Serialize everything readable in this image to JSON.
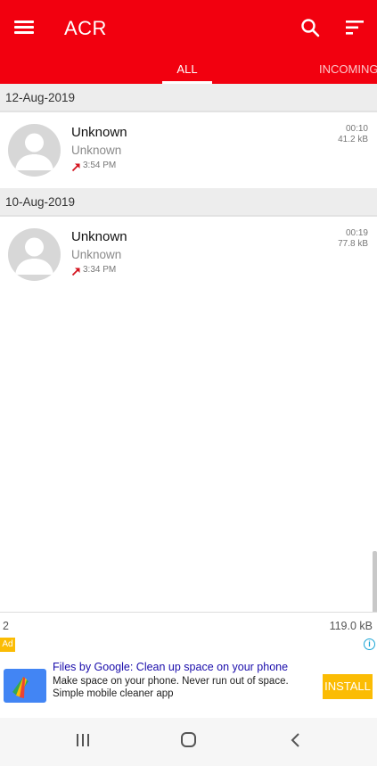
{
  "app": {
    "title": "ACR",
    "brand_color": "#f2000f"
  },
  "toolbar": {
    "menu_icon": "hamburger-menu-icon",
    "search_icon": "search-icon",
    "sort_icon": "sort-icon"
  },
  "tabs": [
    {
      "label": "ALL",
      "selected": true
    },
    {
      "label": "INCOMING",
      "selected": false
    }
  ],
  "groups": [
    {
      "date": "12-Aug-2019",
      "calls": [
        {
          "name": "Unknown",
          "number": "Unknown",
          "time": "3:54 PM",
          "duration": "00:10",
          "size": "41.2 kB",
          "direction": "outgoing"
        }
      ]
    },
    {
      "date": "10-Aug-2019",
      "calls": [
        {
          "name": "Unknown",
          "number": "Unknown",
          "time": "3:34 PM",
          "duration": "00:19",
          "size": "77.8 kB",
          "direction": "outgoing"
        }
      ]
    }
  ],
  "summary": {
    "count": "2",
    "total_size": "119.0 kB"
  },
  "ad": {
    "badge": "Ad",
    "info": "i",
    "title": "Files by Google: Clean up space on your phone",
    "body": "Make space on your phone. Never run out of space. Simple mobile cleaner app",
    "cta": "INSTALL",
    "cta_color": "#fbbc04"
  },
  "navbar": {
    "recents_icon": "recent-apps-icon",
    "home_icon": "home-icon",
    "back_icon": "back-icon"
  }
}
